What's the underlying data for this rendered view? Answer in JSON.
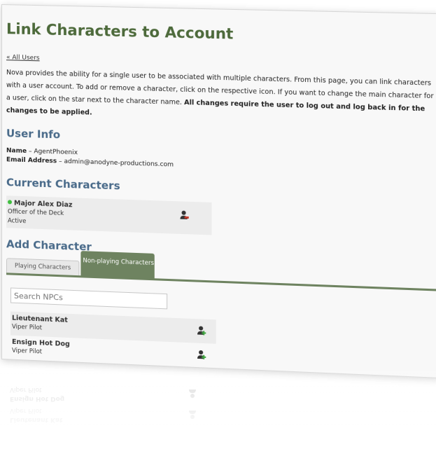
{
  "page": {
    "title": "Link Characters to Account",
    "back_link": "« All Users",
    "intro_text": "Nova provides the ability for a single user to be associated with multiple characters. From this page, you can link characters with a user account. To add or remove a character, click on the respective icon. If you want to change the main character for a user, click on the star next to the character name.",
    "intro_bold": "All changes require the user to log out and log back in for the changes to be applied."
  },
  "user_info": {
    "heading": "User Info",
    "name_label": "Name",
    "name_value": " – AgentPhoenix",
    "email_label": "Email Address",
    "email_value": " – admin@anodyne-productions.com"
  },
  "current": {
    "heading": "Current Characters",
    "characters": [
      {
        "name": "Major Alex Diaz",
        "position": "Officer of the Deck",
        "status": "Active",
        "icon": "remove-user-icon"
      }
    ]
  },
  "add": {
    "heading": "Add Character",
    "tabs": [
      "Playing Characters",
      "Non-playing Characters"
    ],
    "active_tab": "Non-playing Characters",
    "search_placeholder": "Search NPCs",
    "npcs": [
      {
        "name": "Lieutenant Kat",
        "position": "Viper Pilot",
        "icon": "add-user-icon"
      },
      {
        "name": "Ensign Hot Dog",
        "position": "Viper Pilot",
        "icon": "add-user-icon"
      }
    ]
  },
  "colors": {
    "heading_green": "#4d6a3b",
    "heading_blue": "#4a6b8a",
    "tab_active": "#6e8360",
    "status_green": "#3fbf3f",
    "remove_icon": "#c0392b",
    "add_icon": "#3fa33f"
  }
}
